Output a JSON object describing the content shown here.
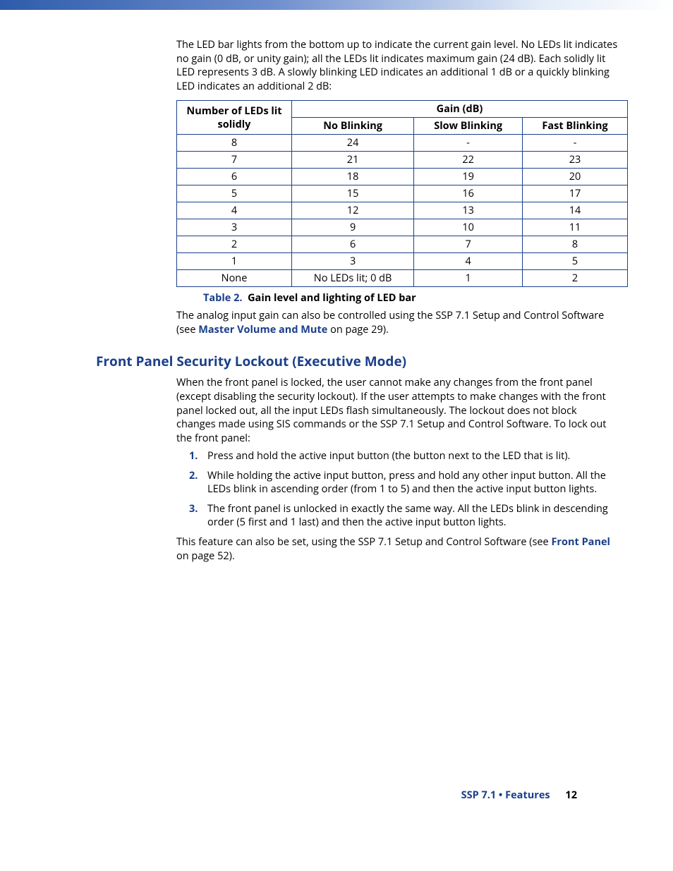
{
  "intro_paragraph": "The LED bar lights from the bottom up to indicate the current gain level. No LEDs lit indicates no gain (0 dB, or unity gain); all the LEDs lit indicates maximum gain (24 dB). Each solidly lit LED represents 3 dB. A slowly blinking LED indicates an additional 1 dB or a quickly blinking LED indicates an additional 2 dB:",
  "table": {
    "col_leds": "Number of LEDs lit solidly",
    "col_gain": "Gain (dB)",
    "sub_no": "No Blinking",
    "sub_slow": "Slow Blinking",
    "sub_fast": "Fast Blinking",
    "rows": [
      {
        "leds": "8",
        "no": "24",
        "slow": "-",
        "fast": "-"
      },
      {
        "leds": "7",
        "no": "21",
        "slow": "22",
        "fast": "23"
      },
      {
        "leds": "6",
        "no": "18",
        "slow": "19",
        "fast": "20"
      },
      {
        "leds": "5",
        "no": "15",
        "slow": "16",
        "fast": "17"
      },
      {
        "leds": "4",
        "no": "12",
        "slow": "13",
        "fast": "14"
      },
      {
        "leds": "3",
        "no": "9",
        "slow": "10",
        "fast": "11"
      },
      {
        "leds": "2",
        "no": "6",
        "slow": "7",
        "fast": "8"
      },
      {
        "leds": "1",
        "no": "3",
        "slow": "4",
        "fast": "5"
      },
      {
        "leds": "None",
        "no": "No LEDs lit; 0 dB",
        "slow": "1",
        "fast": "2"
      }
    ]
  },
  "caption_label": "Table 2.",
  "caption_text": "Gain level and lighting of LED bar",
  "after_table_pre": "The analog input gain can also be controlled using the SSP 7.1 Setup and Control Software (see ",
  "after_table_link": "Master Volume and Mute",
  "after_table_post": " on page 29).",
  "section_heading": "Front Panel Security Lockout (Executive Mode)",
  "lockout_intro": "When the front panel is locked, the user cannot make any changes from the front panel (except disabling the security lockout). If the user attempts to make changes with the front panel locked out, all the input LEDs flash simultaneously. The lockout does not block changes made using SIS commands or the SSP 7.1 Setup and Control Software. To lock out the front panel:",
  "steps": [
    "Press and hold the active input button (the button next to the LED that is lit).",
    "While holding the active input button, press and hold any other input button. All the LEDs blink in ascending order (from 1 to 5) and then the active input button lights.",
    "The front panel is unlocked in exactly the same way. All the LEDs blink in descending order (5 first and 1 last) and then the active input button lights."
  ],
  "closing_pre": "This feature can also be set, using the SSP 7.1 Setup and Control Software (see ",
  "closing_link": "Front Panel",
  "closing_post": " on page 52).",
  "footer_doc": "SSP 7.1 • Features",
  "footer_page": "12"
}
